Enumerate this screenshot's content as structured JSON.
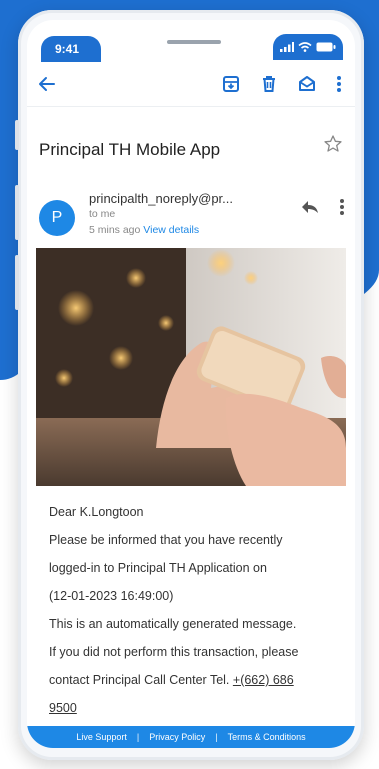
{
  "status": {
    "time": "9:41"
  },
  "email": {
    "subject": "Principal TH Mobile App",
    "sender": {
      "avatar_letter": "P",
      "name": "principalth_noreply@pr...",
      "to": "to me",
      "time_ago": "5 mins ago",
      "view_details": "View details"
    },
    "body": {
      "greeting": "Dear K.Longtoon",
      "line1": "Please be informed that you have recently",
      "line2": "logged-in to Principal TH Application on",
      "line3": "(12-01-2023 16:49:00)",
      "line4": "This is an automatically generated message.",
      "line5": "If you did not perform this transaction, please",
      "line6_prefix": "contact Principal Call Center Tel. ",
      "tel_part1": "+(662) 686",
      "tel_part2": "9500"
    }
  },
  "footer": {
    "live_support": "Live Support",
    "privacy_policy": "Privacy Policy",
    "terms": "Terms & Conditions",
    "separator": "|"
  },
  "colors": {
    "brand_blue": "#1e6fd0",
    "link_blue": "#1e88e5"
  }
}
